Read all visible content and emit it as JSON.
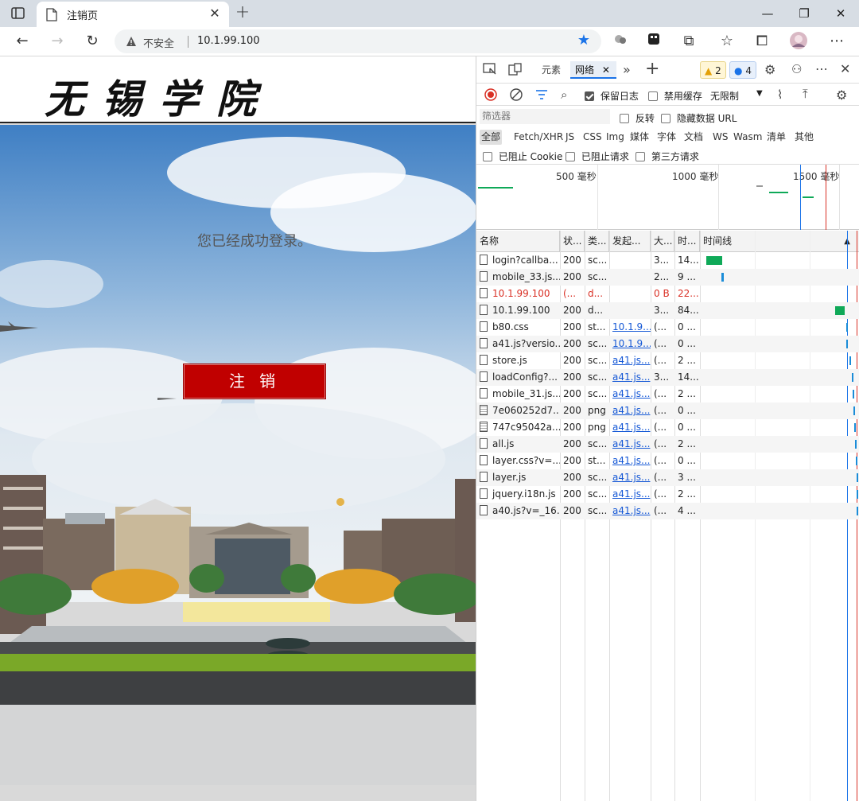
{
  "browser": {
    "tab_title": "注销页",
    "security_label": "不安全",
    "url": "10.1.99.100"
  },
  "page": {
    "logo_text": "无锡学院",
    "message": "您已经成功登录。",
    "logout_label": "注 销"
  },
  "devtools": {
    "tabs": [
      "元素",
      "网络"
    ],
    "active_tab": "网络",
    "warning_count": "2",
    "info_count": "4",
    "preserve_log_label": "保留日志",
    "disable_cache_label": "禁用缓存",
    "throttle_label": "无限制",
    "filter_placeholder": "筛选器",
    "invert_label": "反转",
    "hide_data_urls_label": "隐藏数据 URL",
    "type_filters": [
      "全部",
      "Fetch/XHR",
      "JS",
      "CSS",
      "Img",
      "媒体",
      "字体",
      "文档",
      "WS",
      "Wasm",
      "清单",
      "其他"
    ],
    "blocked_cookies_label": "已阻止 Cookie",
    "blocked_requests_label": "已阻止请求",
    "third_party_label": "第三方请求",
    "overview_ticks": [
      "500 毫秒",
      "1000 毫秒",
      "1500 毫秒"
    ],
    "columns": [
      "名称",
      "状...",
      "类...",
      "发起...",
      "大...",
      "时...",
      "时间线"
    ],
    "requests": [
      {
        "name": "login?callba...",
        "status": "200",
        "type": "sc...",
        "initiator": "",
        "size": "3...",
        "time": "14..."
      },
      {
        "name": "mobile_33.js...",
        "status": "200",
        "type": "sc...",
        "initiator": "",
        "size": "2...",
        "time": "9 ..."
      },
      {
        "name": "10.1.99.100",
        "status": "(...",
        "type": "d...",
        "initiator": "",
        "size": "0 B",
        "time": "22...",
        "error": true
      },
      {
        "name": "10.1.99.100",
        "status": "200",
        "type": "d...",
        "initiator": "",
        "size": "3...",
        "time": "84..."
      },
      {
        "name": "b80.css",
        "status": "200",
        "type": "st...",
        "initiator": "10.1.9...",
        "size": "(...",
        "time": "0 ..."
      },
      {
        "name": "a41.js?versio...",
        "status": "200",
        "type": "sc...",
        "initiator": "10.1.9...",
        "size": "(...",
        "time": "0 ..."
      },
      {
        "name": "store.js",
        "status": "200",
        "type": "sc...",
        "initiator": "a41.js...",
        "size": "(...",
        "time": "2 ..."
      },
      {
        "name": "loadConfig?...",
        "status": "200",
        "type": "sc...",
        "initiator": "a41.js...",
        "size": "3...",
        "time": "14..."
      },
      {
        "name": "mobile_31.js...",
        "status": "200",
        "type": "sc...",
        "initiator": "a41.js...",
        "size": "(...",
        "time": "2 ..."
      },
      {
        "name": "7e060252d7...",
        "status": "200",
        "type": "png",
        "initiator": "a41.js...",
        "size": "(...",
        "time": "0 ...",
        "img": true
      },
      {
        "name": "747c95042a...",
        "status": "200",
        "type": "png",
        "initiator": "a41.js...",
        "size": "(...",
        "time": "0 ...",
        "img": true
      },
      {
        "name": "all.js",
        "status": "200",
        "type": "sc...",
        "initiator": "a41.js...",
        "size": "(...",
        "time": "2 ..."
      },
      {
        "name": "layer.css?v=...",
        "status": "200",
        "type": "st...",
        "initiator": "a41.js...",
        "size": "(...",
        "time": "0 ..."
      },
      {
        "name": "layer.js",
        "status": "200",
        "type": "sc...",
        "initiator": "a41.js...",
        "size": "(...",
        "time": "3 ..."
      },
      {
        "name": "jquery.i18n.js",
        "status": "200",
        "type": "sc...",
        "initiator": "a41.js...",
        "size": "(...",
        "time": "2 ..."
      },
      {
        "name": "a40.js?v=_16...",
        "status": "200",
        "type": "sc...",
        "initiator": "a41.js...",
        "size": "(...",
        "time": "4 ..."
      }
    ]
  },
  "colors": {
    "logout_red": "#c00000",
    "link_blue": "#1558d6",
    "error_red": "#d93025",
    "waterfall_green": "#0fa958",
    "waterfall_blue": "#1a8cd8"
  }
}
